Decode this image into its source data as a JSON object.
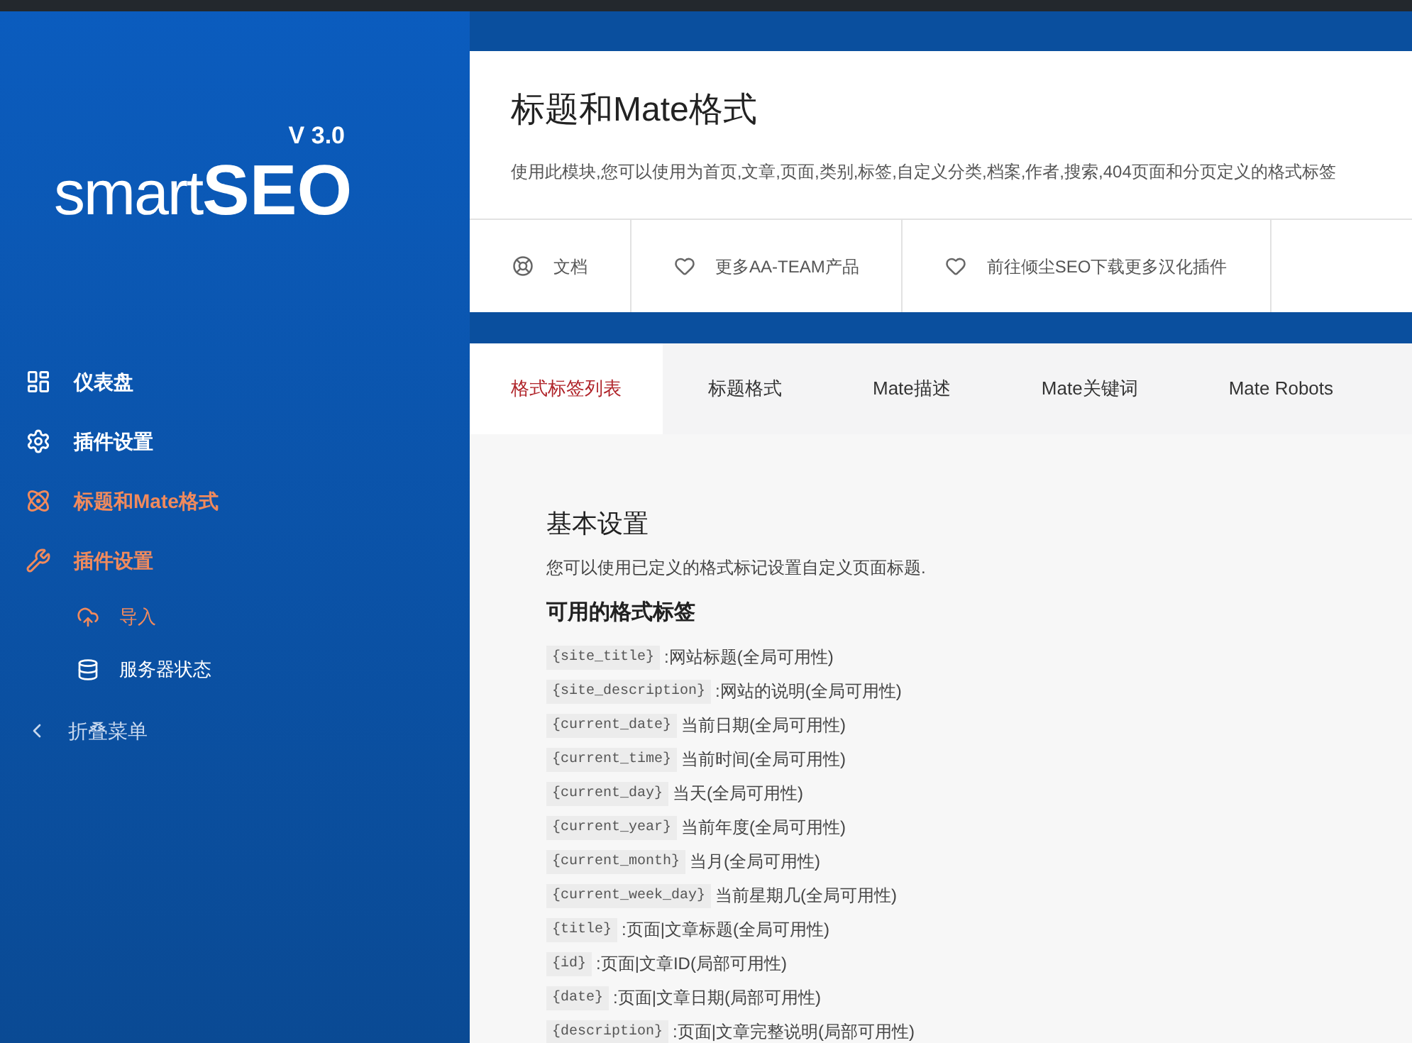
{
  "logo": {
    "light": "smart",
    "bold": "SEO",
    "version": "V 3.0"
  },
  "sidebar": {
    "items": [
      {
        "label": "仪表盘",
        "kind": "dashboard",
        "selected": false
      },
      {
        "label": "插件设置",
        "kind": "gear",
        "selected": false
      },
      {
        "label": "标题和Mate格式",
        "kind": "atom",
        "selected": true
      },
      {
        "label": "插件设置",
        "kind": "tools",
        "selected": true,
        "children": [
          {
            "label": "导入",
            "kind": "cloud",
            "selected": true
          },
          {
            "label": "服务器状态",
            "kind": "database",
            "selected": false
          }
        ]
      }
    ],
    "collapse": "折叠菜单"
  },
  "header": {
    "title": "标题和Mate格式",
    "description": "使用此模块,您可以使用为首页,文章,页面,类别,标签,自定义分类,档案,作者,搜索,404页面和分页定义的格式标签",
    "links": [
      {
        "label": "文档",
        "kind": "lifebuoy"
      },
      {
        "label": "更多AA-TEAM产品",
        "kind": "heart"
      },
      {
        "label": "前往倾尘SEO下载更多汉化插件",
        "kind": "heart"
      }
    ]
  },
  "tabs": [
    {
      "label": "格式标签列表",
      "selected": true
    },
    {
      "label": "标题格式",
      "selected": false
    },
    {
      "label": "Mate描述",
      "selected": false
    },
    {
      "label": "Mate关键词",
      "selected": false
    },
    {
      "label": "Mate Robots",
      "selected": false
    }
  ],
  "content": {
    "heading": "基本设置",
    "intro": "您可以使用已定义的格式标记设置自定义页面标题.",
    "subheading": "可用的格式标签",
    "tags": [
      {
        "code": "{site_title}",
        "text": ":网站标题(全局可用性)"
      },
      {
        "code": "{site_description}",
        "text": ":网站的说明(全局可用性)"
      },
      {
        "code": "{current_date}",
        "text": "当前日期(全局可用性)"
      },
      {
        "code": "{current_time}",
        "text": "当前时间(全局可用性)"
      },
      {
        "code": "{current_day}",
        "text": "当天(全局可用性)"
      },
      {
        "code": "{current_year}",
        "text": "当前年度(全局可用性)"
      },
      {
        "code": "{current_month}",
        "text": "当月(全局可用性)"
      },
      {
        "code": "{current_week_day}",
        "text": "当前星期几(全局可用性)"
      },
      {
        "code": "{title}",
        "text": ":页面|文章标题(全局可用性)"
      },
      {
        "code": "{id}",
        "text": ":页面|文章ID(局部可用性)"
      },
      {
        "code": "{date}",
        "text": ":页面|文章日期(局部可用性)"
      },
      {
        "code": "{description}",
        "text": ":页面|文章完整说明(局部可用性)"
      }
    ]
  }
}
